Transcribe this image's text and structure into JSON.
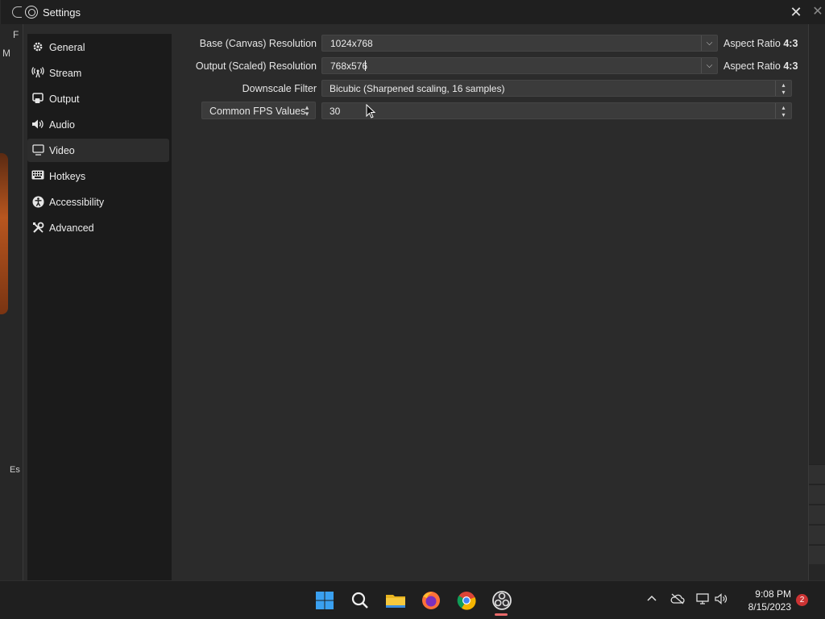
{
  "window": {
    "title": "Settings",
    "close_symbol": "✕"
  },
  "sidebar": {
    "items": [
      {
        "label": "General",
        "icon": "gear-icon"
      },
      {
        "label": "Stream",
        "icon": "broadcast-icon"
      },
      {
        "label": "Output",
        "icon": "output-icon"
      },
      {
        "label": "Audio",
        "icon": "speaker-icon"
      },
      {
        "label": "Video",
        "icon": "monitor-icon",
        "active": true
      },
      {
        "label": "Hotkeys",
        "icon": "keyboard-icon"
      },
      {
        "label": "Accessibility",
        "icon": "accessibility-icon"
      },
      {
        "label": "Advanced",
        "icon": "tools-icon"
      }
    ]
  },
  "video": {
    "base_label": "Base (Canvas) Resolution",
    "base_value": "1024x768",
    "base_aspect_prefix": "Aspect Ratio",
    "base_aspect_value": "4:3",
    "output_label": "Output (Scaled) Resolution",
    "output_value": "768x576",
    "output_aspect_prefix": "Aspect Ratio",
    "output_aspect_value": "4:3",
    "downscale_label": "Downscale Filter",
    "downscale_value": "Bicubic (Sharpened scaling, 16 samples)",
    "fps_type": "Common FPS Values",
    "fps_value": "30"
  },
  "background": {
    "letters": [
      "F",
      "M",
      "Es"
    ]
  },
  "taskbar": {
    "time": "9:08 PM",
    "date": "8/15/2023",
    "notification_count": "2",
    "apps": [
      "start-icon",
      "search-icon",
      "file-explorer-icon",
      "firefox-icon",
      "chrome-icon",
      "obs-icon"
    ]
  },
  "colors": {
    "accent_active_app": "#e96a6a",
    "window_bg": "#2b2b2b",
    "sidebar_bg": "#1b1b1b",
    "field_bg": "#3b3b3b"
  }
}
